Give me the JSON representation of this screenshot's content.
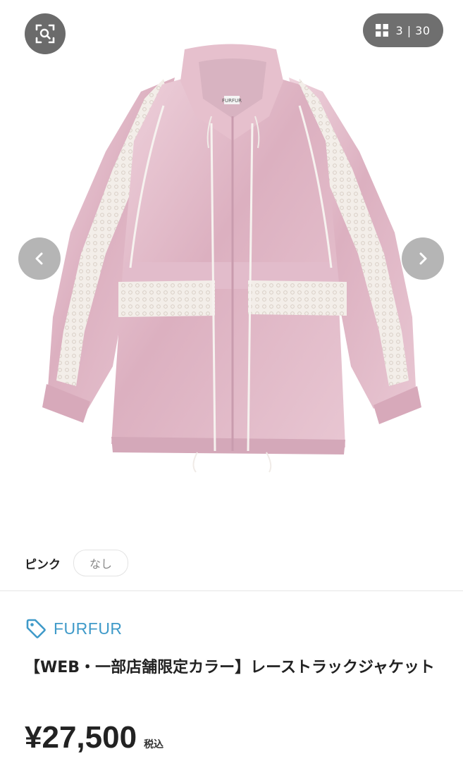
{
  "gallery": {
    "counter": "3 | 30",
    "icons": {
      "lens": "image-search-icon",
      "grid": "grid-icon",
      "prev": "chevron-left-icon",
      "next": "chevron-right-icon"
    },
    "product_label_tag": "FURFUR"
  },
  "variant": {
    "color_label": "ピンク",
    "option_chip": "なし"
  },
  "product": {
    "brand": "FURFUR",
    "brand_icon": "tag-icon",
    "title": "【WEB・一部店舗限定カラー】レーストラックジャケット",
    "price": "¥27,500",
    "tax_label": "税込"
  },
  "colors": {
    "brand_blue": "#3f9ac9",
    "jacket_pink": "#e6c2cf",
    "overlay_gray": "#6b6b6b"
  }
}
